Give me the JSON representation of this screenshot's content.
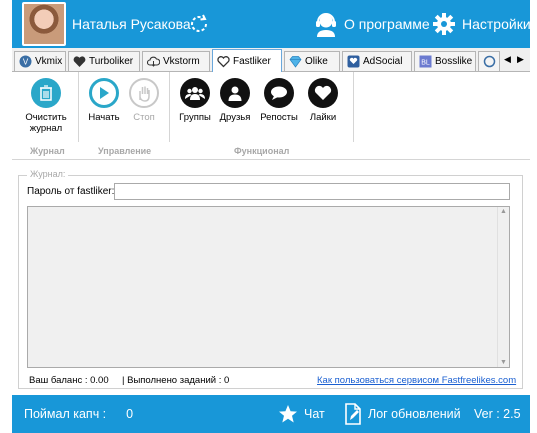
{
  "header": {
    "username": "Наталья Русакова",
    "about_label": "О программе",
    "settings_label": "Настройки"
  },
  "tabs": [
    {
      "label": "Vkmix",
      "icon": "vkmix-icon"
    },
    {
      "label": "Turboliker",
      "icon": "heart-icon"
    },
    {
      "label": "Vkstorm",
      "icon": "cloud-icon"
    },
    {
      "label": "Fastliker",
      "icon": "heart-outline-icon",
      "active": true
    },
    {
      "label": "Olike",
      "icon": "diamond-icon"
    },
    {
      "label": "AdSocial",
      "icon": "adsocial-icon"
    },
    {
      "label": "Bosslike",
      "icon": "bosslike-icon"
    }
  ],
  "toolbar": {
    "clear_log_label": "Очистить журнал",
    "start_label": "Начать",
    "stop_label": "Стоп",
    "groups_label": "Группы",
    "friends_label": "Друзья",
    "reposts_label": "Репосты",
    "likes_label": "Лайки",
    "section_log": "Журнал",
    "section_control": "Управление",
    "section_functional": "Функционал"
  },
  "content": {
    "legend": "Журнал:",
    "password_label": "Пароль от fastliker:",
    "password_value": "",
    "balance_text": "Ваш баланс :  0.00",
    "tasks_text": "|   Выполнено заданий :  0",
    "help_link": "Как пользоваться сервисом Fastfreelikes.com"
  },
  "footer": {
    "captcha_label": "Поймал капч :",
    "captcha_count": "0",
    "chat_label": "Чат",
    "changelog_label": "Лог обновлений",
    "version": "Ver : 2.5"
  },
  "colors": {
    "brand_blue": "#1897d8",
    "teal": "#2aa7c9",
    "link": "#1a5fd1"
  }
}
